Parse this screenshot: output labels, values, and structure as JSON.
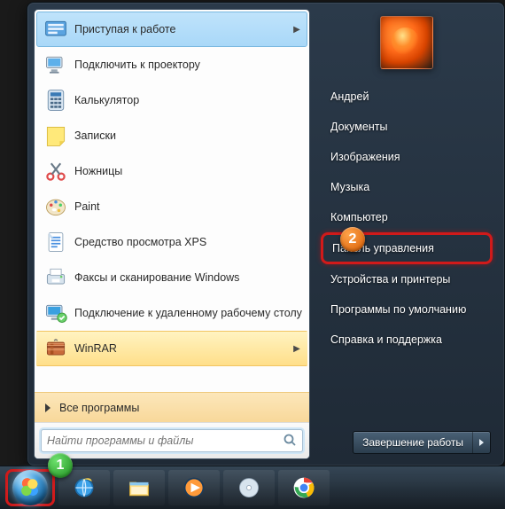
{
  "programs": [
    {
      "label": "Приступая к работе",
      "icon": "getting-started-icon",
      "submenu": true,
      "highlighted": true
    },
    {
      "label": "Подключить к проектору",
      "icon": "projector-icon"
    },
    {
      "label": "Калькулятор",
      "icon": "calculator-icon"
    },
    {
      "label": "Записки",
      "icon": "sticky-notes-icon"
    },
    {
      "label": "Ножницы",
      "icon": "snipping-tool-icon"
    },
    {
      "label": "Paint",
      "icon": "paint-icon"
    },
    {
      "label": "Средство просмотра XPS",
      "icon": "xps-viewer-icon"
    },
    {
      "label": "Факсы и сканирование Windows",
      "icon": "fax-scan-icon"
    },
    {
      "label": "Подключение к удаленному рабочему столу",
      "icon": "remote-desktop-icon"
    },
    {
      "label": "WinRAR",
      "icon": "winrar-icon",
      "submenu": true,
      "winrar": true
    }
  ],
  "all_programs_label": "Все программы",
  "search_placeholder": "Найти программы и файлы",
  "right_items": [
    {
      "label": "Андрей"
    },
    {
      "label": "Документы"
    },
    {
      "label": "Изображения"
    },
    {
      "label": "Музыка"
    },
    {
      "label": "Компьютер"
    },
    {
      "label": "Панель управления",
      "callout": true
    },
    {
      "label": "Устройства и принтеры"
    },
    {
      "label": "Программы по умолчанию"
    },
    {
      "label": "Справка и поддержка"
    }
  ],
  "shutdown_label": "Завершение работы",
  "badges": {
    "start": "1",
    "control_panel": "2"
  },
  "taskbar": [
    {
      "name": "internet-explorer"
    },
    {
      "name": "file-explorer"
    },
    {
      "name": "media-player"
    },
    {
      "name": "generic-app"
    },
    {
      "name": "chrome"
    }
  ]
}
